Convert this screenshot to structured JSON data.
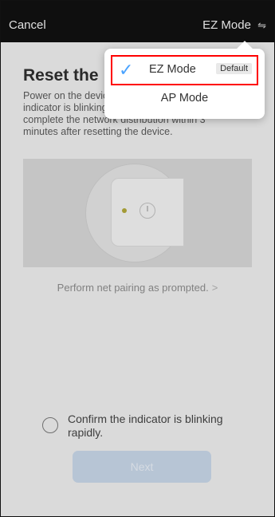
{
  "header": {
    "cancel_label": "Cancel",
    "mode_label": "EZ Mode",
    "mode_icon": "⇋"
  },
  "main": {
    "title": "Reset the",
    "description": "Power on the device and confirm that the indicator is blinking rapidly. Note: please complete the network distribution within 3 minutes after resetting the device.",
    "pairing_link": "Perform net pairing as prompted.",
    "pairing_link_chevron": ">",
    "confirm_text": "Confirm the indicator is blinking rapidly.",
    "next_button": "Next"
  },
  "popup": {
    "options": [
      {
        "label": "EZ Mode",
        "badge": "Default",
        "selected": true,
        "check_icon": "✓"
      },
      {
        "label": "AP Mode",
        "selected": false
      }
    ]
  }
}
